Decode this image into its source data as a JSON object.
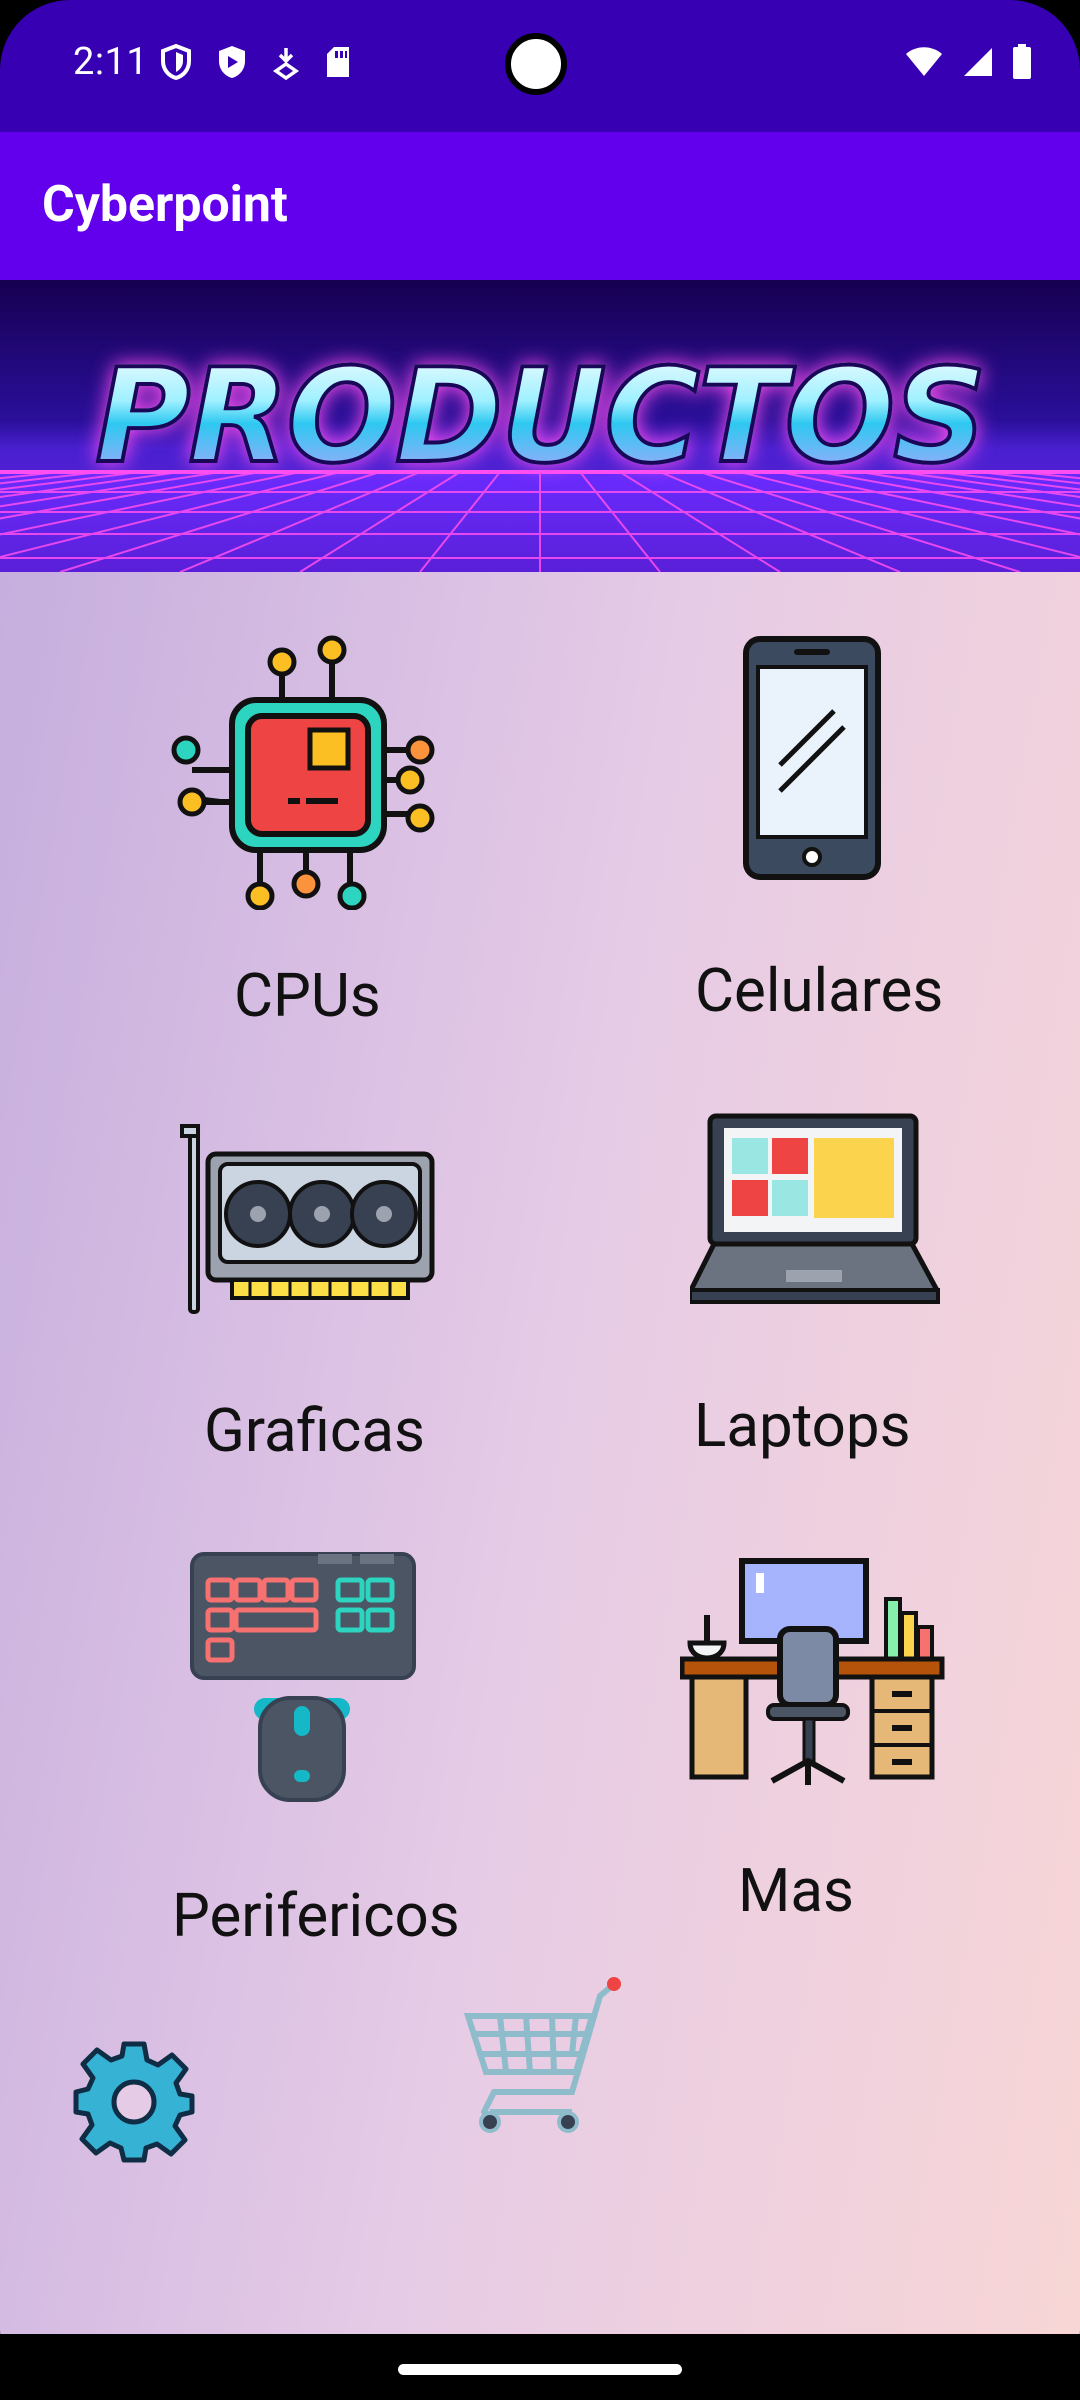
{
  "status_bar": {
    "time": "2:11",
    "left_icons": [
      "vpn-shield-icon",
      "security-shield-icon",
      "download-icon",
      "sd-card-icon"
    ],
    "right_icons": [
      "wifi-icon",
      "cellular-signal-icon",
      "battery-icon"
    ]
  },
  "app_bar": {
    "title": "Cyberpoint"
  },
  "banner": {
    "text": "PRODUCTOS"
  },
  "products": [
    {
      "label": "CPUs",
      "icon": "cpu-chip-icon"
    },
    {
      "label": "Celulares",
      "icon": "smartphone-icon"
    },
    {
      "label": "Graficas",
      "icon": "graphics-card-icon"
    },
    {
      "label": "Laptops",
      "icon": "laptop-icon"
    },
    {
      "label": "Perifericos",
      "icon": "keyboard-mouse-icon"
    },
    {
      "label": "Mas",
      "icon": "desk-workstation-icon"
    }
  ],
  "bottom_actions": [
    {
      "name": "settings",
      "icon": "gear-icon"
    },
    {
      "name": "cart",
      "icon": "shopping-cart-icon"
    }
  ],
  "colors": {
    "status_bar": "#3700b3",
    "app_bar": "#6200ee",
    "gear": "#35b2d4",
    "cart": "#8fbccb"
  }
}
